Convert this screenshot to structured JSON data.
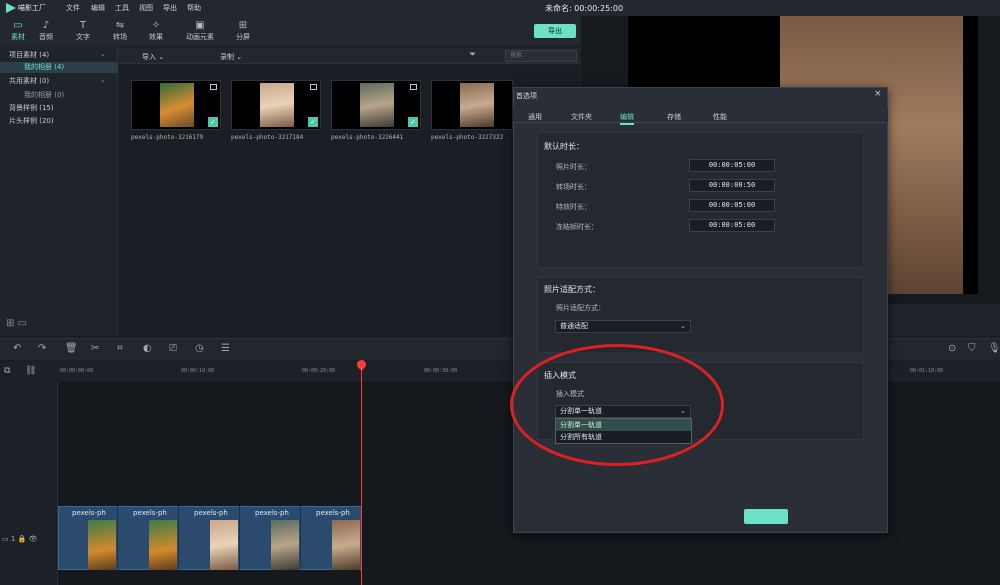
{
  "app": {
    "logo_text": "喵影工厂",
    "doc_title": "未命名: 00:00:25:00"
  },
  "menu": [
    "文件",
    "编辑",
    "工具",
    "视图",
    "导出",
    "帮助"
  ],
  "media_tabs": [
    {
      "label": "素材",
      "icon": "folder-icon",
      "active": true
    },
    {
      "label": "音频",
      "icon": "music-icon"
    },
    {
      "label": "文字",
      "icon": "text-icon"
    },
    {
      "label": "转场",
      "icon": "transition-icon"
    },
    {
      "label": "效果",
      "icon": "effect-icon"
    },
    {
      "label": "动画元素",
      "icon": "image-icon"
    },
    {
      "label": "分屏",
      "icon": "split-screen-icon"
    }
  ],
  "export_label": "导出",
  "library": {
    "items": [
      {
        "label": "项目素材 (4)"
      },
      {
        "label": "我的相册 (4)",
        "selected": true
      },
      {
        "label": "共用素材 (0)"
      },
      {
        "label": "我的相册 (0)"
      },
      {
        "label": "背景样例 (15)"
      },
      {
        "label": "片头样例 (20)"
      }
    ]
  },
  "media_bar": {
    "import_label": "导入",
    "record_label": "录制",
    "search_placeholder": "搜索"
  },
  "thumbnails": [
    {
      "label": "pexels-photo-3216179"
    },
    {
      "label": "pexels-photo-3217184"
    },
    {
      "label": "pexels-photo-3226441"
    },
    {
      "label": "pexels-photo-3227322"
    }
  ],
  "timeline": {
    "ruler": [
      "00:00:00:00",
      "00:00:10:00",
      "00:00:20:00",
      "00:00:30:00",
      "00:01:10:00"
    ],
    "clip_label": "pexels-ph",
    "track_label": "1"
  },
  "dialog": {
    "title": "首选项",
    "close": "×",
    "tabs": [
      {
        "label": "通用"
      },
      {
        "label": "文件夹"
      },
      {
        "label": "编辑",
        "active": true
      },
      {
        "label": "存储"
      },
      {
        "label": "性能"
      }
    ],
    "default_duration": {
      "title": "默认时长：",
      "fields": [
        {
          "label": "照片时长：",
          "value": "00:00:05:00"
        },
        {
          "label": "转场时长：",
          "value": "00:00:00:50"
        },
        {
          "label": "特效时长：",
          "value": "00:00:05:00"
        },
        {
          "label": "冻结帧时长：",
          "value": "00:00:05:00"
        }
      ]
    },
    "photo_fit": {
      "title": "照片适配方式：",
      "label": "照片适配方式：",
      "value": "普通适配"
    },
    "insert_mode": {
      "title": "插入模式",
      "label": "插入模式",
      "value": "分割单一轨道",
      "options": [
        "分割单一轨道",
        "分割所有轨道"
      ]
    }
  },
  "colors": {
    "accent": "#6de0c8",
    "playhead": "#ff3b3b",
    "annotation": "#e02020"
  }
}
